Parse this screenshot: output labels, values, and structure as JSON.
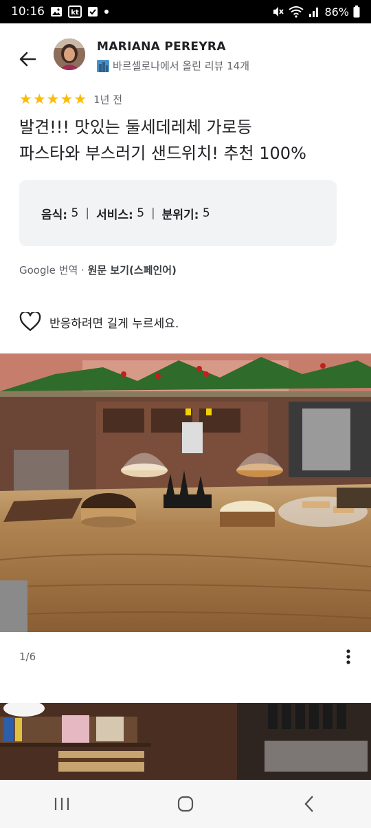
{
  "status_bar": {
    "time": "10:16",
    "carrier_badge": "kt",
    "battery": "86%",
    "icons": [
      "image-icon",
      "kt-icon",
      "check-icon",
      "dot-icon",
      "mute-icon",
      "wifi-icon",
      "signal-icon",
      "battery-icon"
    ]
  },
  "reviewer": {
    "name": "MARIANA PEREYRA",
    "meta": "바르셀로나에서 올린 리뷰 14개"
  },
  "rating": {
    "stars": 5,
    "time_ago": "1년 전"
  },
  "review": {
    "line1": "발견!!! 맛있는 둘세데레체 가로등",
    "line2": "파스타와 부스러기 샌드위치! 추천 100%"
  },
  "scores": {
    "food_label": "음식:",
    "food_value": "5",
    "service_label": "서비스:",
    "service_value": "5",
    "atmosphere_label": "분위기:",
    "atmosphere_value": "5",
    "separator": "|"
  },
  "translation": {
    "source": "Google 번역 · ",
    "view_original": "원문 보기(스페인어)"
  },
  "reaction": {
    "hint": "길게 누르세요.",
    "hint_prefix": "반응하려면 "
  },
  "photo": {
    "counter": "1/6"
  },
  "colors": {
    "star": "#fbbc04",
    "text_primary": "#202124",
    "text_secondary": "#5f6368",
    "score_box": "#f1f3f4"
  }
}
